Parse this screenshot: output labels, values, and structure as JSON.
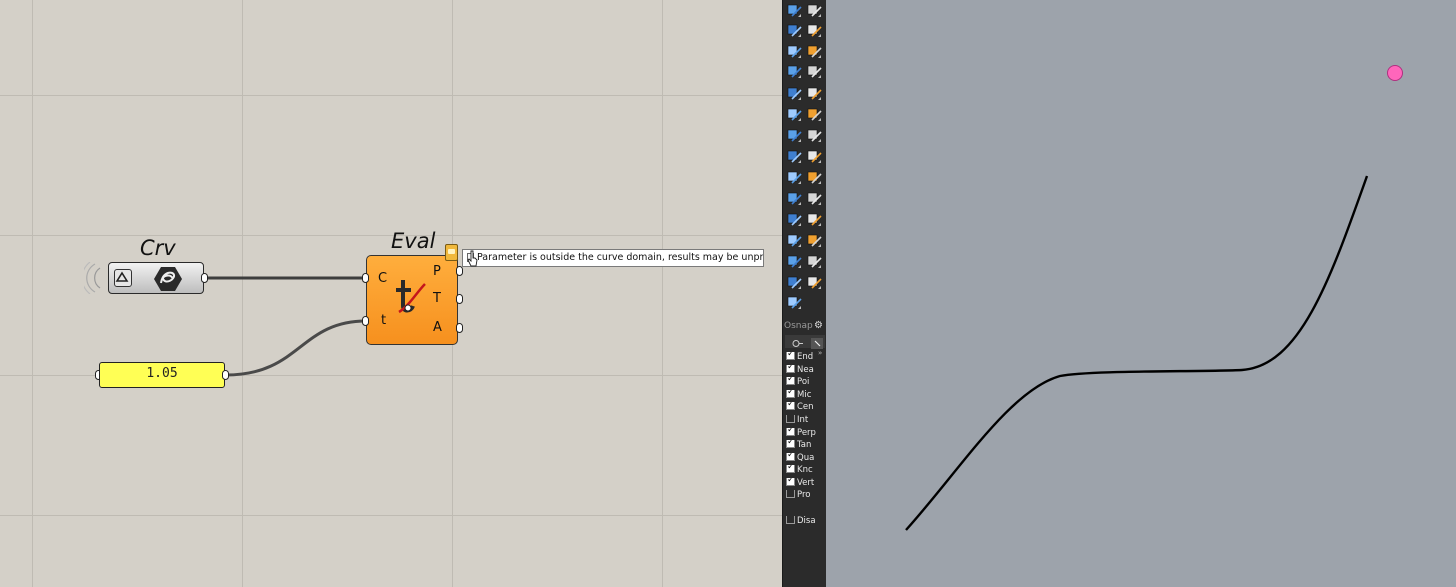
{
  "grasshopper": {
    "crv_label": "Crv",
    "eval_label": "Eval",
    "eval_inputs": [
      "C",
      "t"
    ],
    "eval_outputs": [
      "P",
      "T",
      "A"
    ],
    "slider_value": "1.05",
    "tooltip": "Parameter is outside the curve domain, results may be unpredictable.",
    "colors": {
      "canvas": "#d4d0c8",
      "component": "#f6901e",
      "slider": "#ffff55",
      "warning": "#f0b83c"
    }
  },
  "toolbar": {
    "icons": [
      "osnap-target-icon",
      "arc-icon",
      "box-select-icon",
      "fillet-icon",
      "solid-box-icon",
      "sphere-icon",
      "cylinder-icon",
      "render-icon",
      "explode-icon",
      "surface-icon",
      "dimension-icon",
      "align-icon",
      "boolean-icon",
      "group-icon",
      "curve-icon",
      "rotate-icon",
      "text-icon",
      "scale-icon",
      "array-icon",
      "trim-icon",
      "cube-icon",
      "pipeline-icon",
      "grid-icon",
      "layer-icon",
      "shield-icon",
      "gumball-icon",
      "check-icon",
      "render-material-icon",
      "light-icon"
    ]
  },
  "osnap": {
    "title": "Osnap",
    "items": [
      {
        "label": "End",
        "checked": true
      },
      {
        "label": "Nea",
        "checked": true
      },
      {
        "label": "Poi",
        "checked": true
      },
      {
        "label": "Mic",
        "checked": true
      },
      {
        "label": "Cen",
        "checked": true
      },
      {
        "label": "Int",
        "checked": false
      },
      {
        "label": "Perp",
        "checked": true
      },
      {
        "label": "Tan",
        "checked": true
      },
      {
        "label": "Qua",
        "checked": true
      },
      {
        "label": "Knc",
        "checked": true
      },
      {
        "label": "Vert",
        "checked": true
      },
      {
        "label": "Pro",
        "checked": false
      }
    ],
    "disable_label": "Disa",
    "disable_checked": false
  },
  "viewport": {
    "colors": {
      "background": "#9da3ab",
      "curve": "#000000",
      "point": "#ff66bb"
    }
  }
}
